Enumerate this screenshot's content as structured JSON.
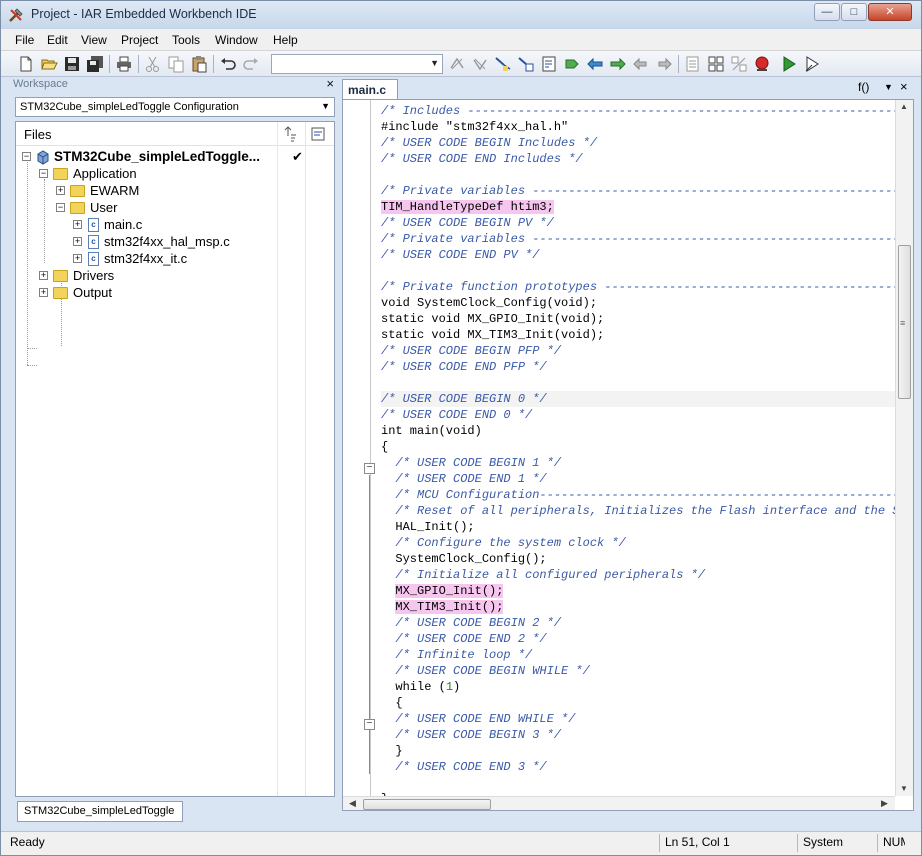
{
  "window": {
    "title": "Project - IAR Embedded Workbench IDE"
  },
  "menu": [
    "File",
    "Edit",
    "View",
    "Project",
    "Tools",
    "Window",
    "Help"
  ],
  "workspace": {
    "title": "Workspace",
    "configuration": "STM32Cube_simpleLedToggle Configuration",
    "files_label": "Files",
    "tab_label": "STM32Cube_simpleLedToggle",
    "tree": [
      {
        "label": "STM32Cube_simpleLedToggle...",
        "check": "✔"
      },
      {
        "label": "Application"
      },
      {
        "label": "EWARM"
      },
      {
        "label": "User"
      },
      {
        "label": "main.c"
      },
      {
        "label": "stm32f4xx_hal_msp.c"
      },
      {
        "label": "stm32f4xx_it.c"
      },
      {
        "label": "Drivers"
      },
      {
        "label": "Output"
      }
    ]
  },
  "editor": {
    "tab_label": "main.c *",
    "function_selector": "f()",
    "lines": [
      "/* Includes ------------------------------------------------------------------*/",
      "#include \"stm32f4xx_hal.h\"",
      "/* USER CODE BEGIN Includes */",
      "/* USER CODE END Includes */",
      "",
      "/* Private variables ---------------------------------------------------------*/",
      "TIM_HandleTypeDef htim3;",
      "/* USER CODE BEGIN PV */",
      "/* Private variables ---------------------------------------------------------*/",
      "/* USER CODE END PV */",
      "",
      "/* Private function prototypes -----------------------------------------------*/",
      "void SystemClock_Config(void);",
      "static void MX_GPIO_Init(void);",
      "static void MX_TIM3_Init(void);",
      "/* USER CODE BEGIN PFP */",
      "/* USER CODE END PFP */",
      "",
      "/* USER CODE BEGIN 0 */",
      "/* USER CODE END 0 */",
      "int main(void)",
      "{",
      "  /* USER CODE BEGIN 1 */",
      "  /* USER CODE END 1 */",
      "  /* MCU Configuration----------------------------------------------------------*/",
      "  /* Reset of all peripherals, Initializes the Flash interface and the Systick. */",
      "  HAL_Init();",
      "  /* Configure the system clock */",
      "  SystemClock_Config();",
      "  /* Initialize all configured peripherals */",
      "  MX_GPIO_Init();",
      "  MX_TIM3_Init();",
      "  /* USER CODE BEGIN 2 */",
      "  /* USER CODE END 2 */",
      "  /* Infinite loop */",
      "  /* USER CODE BEGIN WHILE */",
      "  while (1)",
      "  {",
      "  /* USER CODE END WHILE */",
      "  /* USER CODE BEGIN 3 */",
      "  }",
      "  /* USER CODE END 3 */",
      "",
      "}"
    ]
  },
  "status": {
    "ready": "Ready",
    "position": "Ln 51, Col 1",
    "encoding": "System",
    "mode": "NUM"
  },
  "colors": {
    "comment": "#3a5aa8",
    "highlight": "#f6c6ef",
    "number": "#1e8a1e"
  }
}
